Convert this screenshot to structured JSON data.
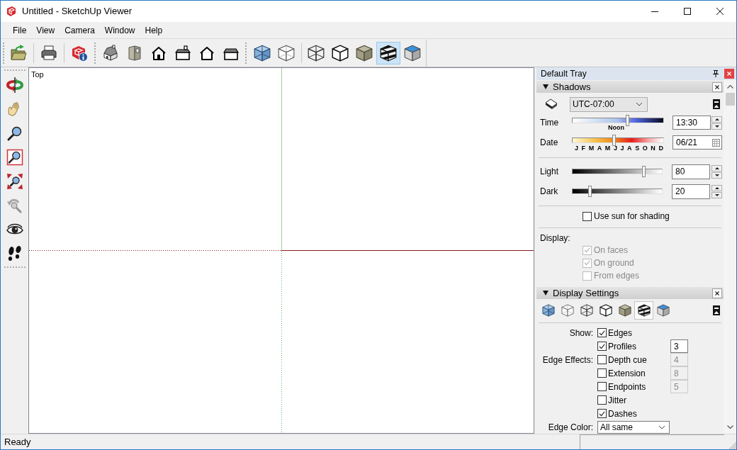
{
  "window": {
    "title": "Untitled - SketchUp Viewer"
  },
  "menu": [
    {
      "label": "File"
    },
    {
      "label": "View"
    },
    {
      "label": "Camera"
    },
    {
      "label": "Window"
    },
    {
      "label": "Help"
    }
  ],
  "toolbar": {
    "face_styles": [
      {
        "selected": false
      },
      {
        "selected": false
      },
      {
        "selected": false
      },
      {
        "selected": false
      },
      {
        "selected": false
      },
      {
        "selected": true
      },
      {
        "selected": false
      }
    ]
  },
  "tools": [
    {
      "disabled": false
    },
    {
      "disabled": false
    },
    {
      "disabled": false
    },
    {
      "disabled": false
    },
    {
      "disabled": false
    },
    {
      "disabled": true
    },
    {
      "disabled": false
    },
    {
      "disabled": false
    }
  ],
  "viewport": {
    "view_label": "Top"
  },
  "tray": {
    "title": "Default Tray",
    "shadows": {
      "title": "Shadows",
      "expanded": true,
      "time_zone": "UTC-07:00",
      "time": {
        "label": "Time",
        "level": 0.61,
        "marker": "Noon",
        "value": "13:30"
      },
      "date": {
        "label": "Date",
        "level": 0.46,
        "months": [
          "J",
          "F",
          "M",
          "A",
          "M",
          "J",
          "J",
          "A",
          "S",
          "O",
          "N",
          "D"
        ],
        "value": "06/21"
      },
      "light": {
        "label": "Light",
        "level": 0.8,
        "value": "80"
      },
      "dark": {
        "label": "Dark",
        "level": 0.2,
        "value": "20"
      },
      "use_sun": {
        "label": "Use sun for shading",
        "checked": false
      },
      "display": {
        "label": "Display:",
        "options": [
          {
            "label": "On faces",
            "checked": true,
            "disabled": true
          },
          {
            "label": "On ground",
            "checked": true,
            "disabled": true
          },
          {
            "label": "From edges",
            "checked": false,
            "disabled": true
          }
        ]
      }
    },
    "display_settings": {
      "title": "Display Settings",
      "expanded": true,
      "styles": [
        {
          "selected": false
        },
        {
          "selected": false
        },
        {
          "selected": false
        },
        {
          "selected": false
        },
        {
          "selected": false
        },
        {
          "selected": true
        },
        {
          "selected": false
        }
      ],
      "options": [
        {
          "heading": "Show:",
          "label": "Edges",
          "checked": true
        },
        {
          "label": "Profiles",
          "checked": true,
          "field": {
            "value": "3",
            "disabled": false
          }
        },
        {
          "heading": "Edge Effects:",
          "label": "Depth cue",
          "checked": false,
          "field": {
            "value": "4",
            "disabled": true
          }
        },
        {
          "label": "Extension",
          "checked": false,
          "field": {
            "value": "8",
            "disabled": true
          }
        },
        {
          "label": "Endpoints",
          "checked": false,
          "field": {
            "value": "5",
            "disabled": true
          }
        },
        {
          "label": "Jitter",
          "checked": false
        },
        {
          "label": "Dashes",
          "checked": true
        }
      ],
      "edge_color": {
        "label": "Edge Color:",
        "value": "All same"
      }
    }
  },
  "status_bar": {
    "text": "Ready"
  }
}
